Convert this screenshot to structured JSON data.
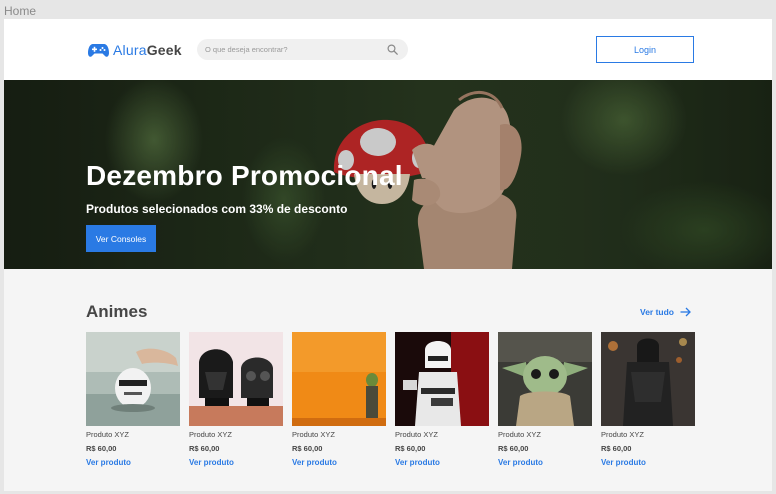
{
  "frame": {
    "label": "Home"
  },
  "header": {
    "logo": {
      "part1": "Alura",
      "part2": "Geek"
    },
    "search": {
      "placeholder": "O que deseja encontrar?"
    },
    "login_label": "Login"
  },
  "banner": {
    "title": "Dezembro Promocional",
    "subtitle": "Produtos selecionados com 33% de desconto",
    "button_label": "Ver Consoles"
  },
  "section": {
    "title": "Animes",
    "see_all": "Ver tudo"
  },
  "products": [
    {
      "name": "Produto XYZ",
      "price": "R$ 60,00",
      "link": "Ver produto",
      "image": "stormtrooper-piggy-bank"
    },
    {
      "name": "Produto XYZ",
      "price": "R$ 60,00",
      "link": "Ver produto",
      "image": "lego-helmets"
    },
    {
      "name": "Produto XYZ",
      "price": "R$ 60,00",
      "link": "Ver produto",
      "image": "yoda-orange"
    },
    {
      "name": "Produto XYZ",
      "price": "R$ 60,00",
      "link": "Ver produto",
      "image": "stormtrooper-figure"
    },
    {
      "name": "Produto XYZ",
      "price": "R$ 60,00",
      "link": "Ver produto",
      "image": "baby-yoda"
    },
    {
      "name": "Produto XYZ",
      "price": "R$ 60,00",
      "link": "Ver produto",
      "image": "kylo-ren"
    }
  ],
  "colors": {
    "accent": "#2a7ae4",
    "text": "#464646",
    "background": "#f5f5f5"
  }
}
